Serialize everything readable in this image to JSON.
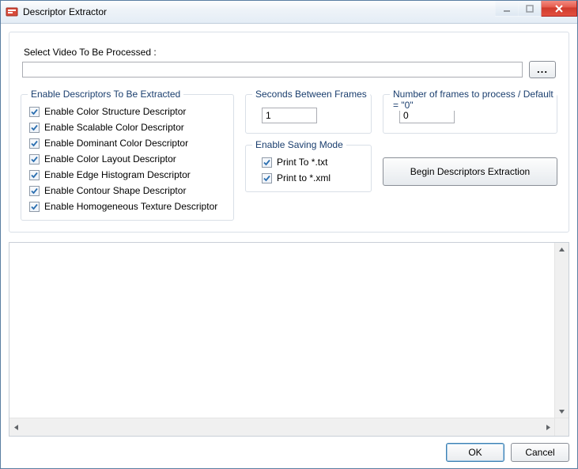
{
  "window": {
    "title": "Descriptor Extractor"
  },
  "video": {
    "section_label": "Select Video To Be Processed :",
    "path_value": "",
    "browse_label": "..."
  },
  "descriptors": {
    "legend": "Enable Descriptors To Be Extracted",
    "items": [
      {
        "label": "Enable Color Structure Descriptor",
        "checked": true
      },
      {
        "label": "Enable Scalable Color Descriptor",
        "checked": true
      },
      {
        "label": "Enable Dominant Color Descriptor",
        "checked": true
      },
      {
        "label": "Enable Color Layout Descriptor",
        "checked": true
      },
      {
        "label": "Enable Edge Histogram Descriptor",
        "checked": true
      },
      {
        "label": "Enable Contour Shape Descriptor",
        "checked": true
      },
      {
        "label": "Enable Homogeneous Texture Descriptor",
        "checked": true
      }
    ]
  },
  "seconds": {
    "legend": "Seconds Between Frames",
    "value": "1"
  },
  "saving": {
    "legend": "Enable Saving Mode",
    "items": [
      {
        "label": "Print To  *.txt",
        "checked": true
      },
      {
        "label": "Print to  *.xml",
        "checked": true
      }
    ]
  },
  "frames": {
    "legend": "Number of frames to process / Default = \"0\"",
    "value": "0"
  },
  "actions": {
    "begin_label": "Begin Descriptors Extraction"
  },
  "buttons": {
    "ok": "OK",
    "cancel": "Cancel"
  }
}
